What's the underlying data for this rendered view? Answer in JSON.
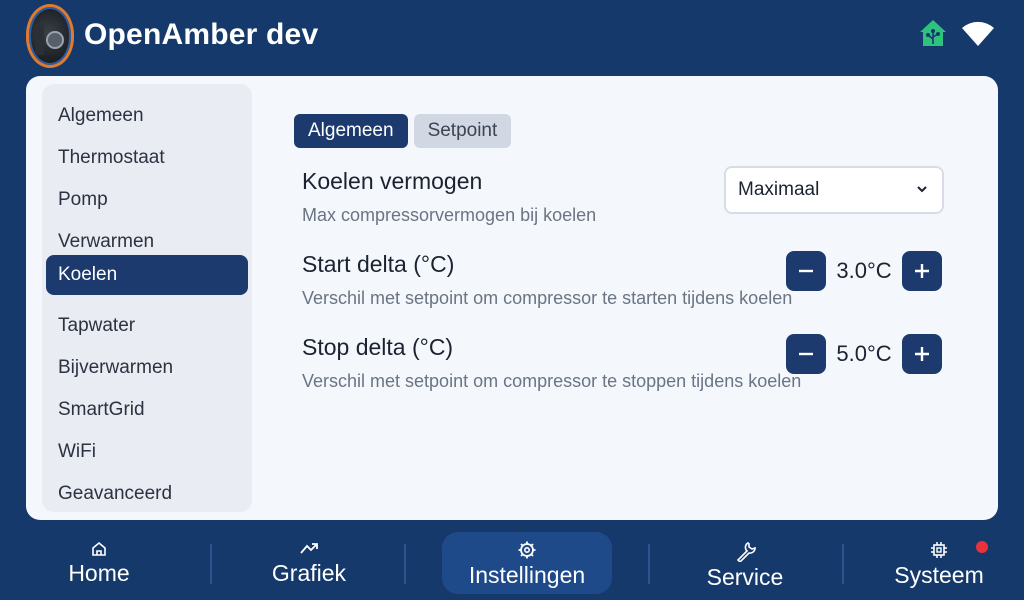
{
  "header": {
    "title": "OpenAmber dev",
    "logo_icon": "heat-pump-logo",
    "status_icons": [
      "home-assistant-icon",
      "wifi-icon"
    ],
    "ha_color": "#41bdf5"
  },
  "sidebar": {
    "items": [
      {
        "label": "Algemeen",
        "active": false
      },
      {
        "label": "Thermostaat",
        "active": false
      },
      {
        "label": "Pomp",
        "active": false
      },
      {
        "label": "Verwarmen",
        "active": false
      },
      {
        "label": "Koelen",
        "active": true
      },
      {
        "label": "Tapwater",
        "active": false
      },
      {
        "label": "Bijverwarmen",
        "active": false
      },
      {
        "label": "SmartGrid",
        "active": false
      },
      {
        "label": "WiFi",
        "active": false
      },
      {
        "label": "Geavanceerd",
        "active": false
      }
    ]
  },
  "tabs": [
    {
      "label": "Algemeen",
      "active": true
    },
    {
      "label": "Setpoint",
      "active": false
    }
  ],
  "settings": {
    "cooling_power": {
      "title": "Koelen vermogen",
      "description": "Max compressorvermogen bij koelen",
      "value": "Maximaal"
    },
    "start_delta": {
      "title": "Start delta (°C)",
      "description": "Verschil met setpoint om compressor te starten tijdens koelen",
      "value": "3.0°C"
    },
    "stop_delta": {
      "title": "Stop delta (°C)",
      "description": "Verschil met setpoint om compressor te stoppen tijdens koelen",
      "value": "5.0°C"
    }
  },
  "bottom_nav": {
    "items": [
      {
        "label": "Home",
        "icon": "home-icon",
        "active": false
      },
      {
        "label": "Grafiek",
        "icon": "chart-icon",
        "active": false
      },
      {
        "label": "Instellingen",
        "icon": "gear-icon",
        "active": true
      },
      {
        "label": "Service",
        "icon": "wrench-icon",
        "active": false
      },
      {
        "label": "Systeem",
        "icon": "chip-icon",
        "active": false
      }
    ],
    "notification_color": "#e8333a"
  },
  "colors": {
    "primary": "#1c3a6e",
    "header_bg": "#16396b",
    "card_bg": "#f4f8fd"
  }
}
